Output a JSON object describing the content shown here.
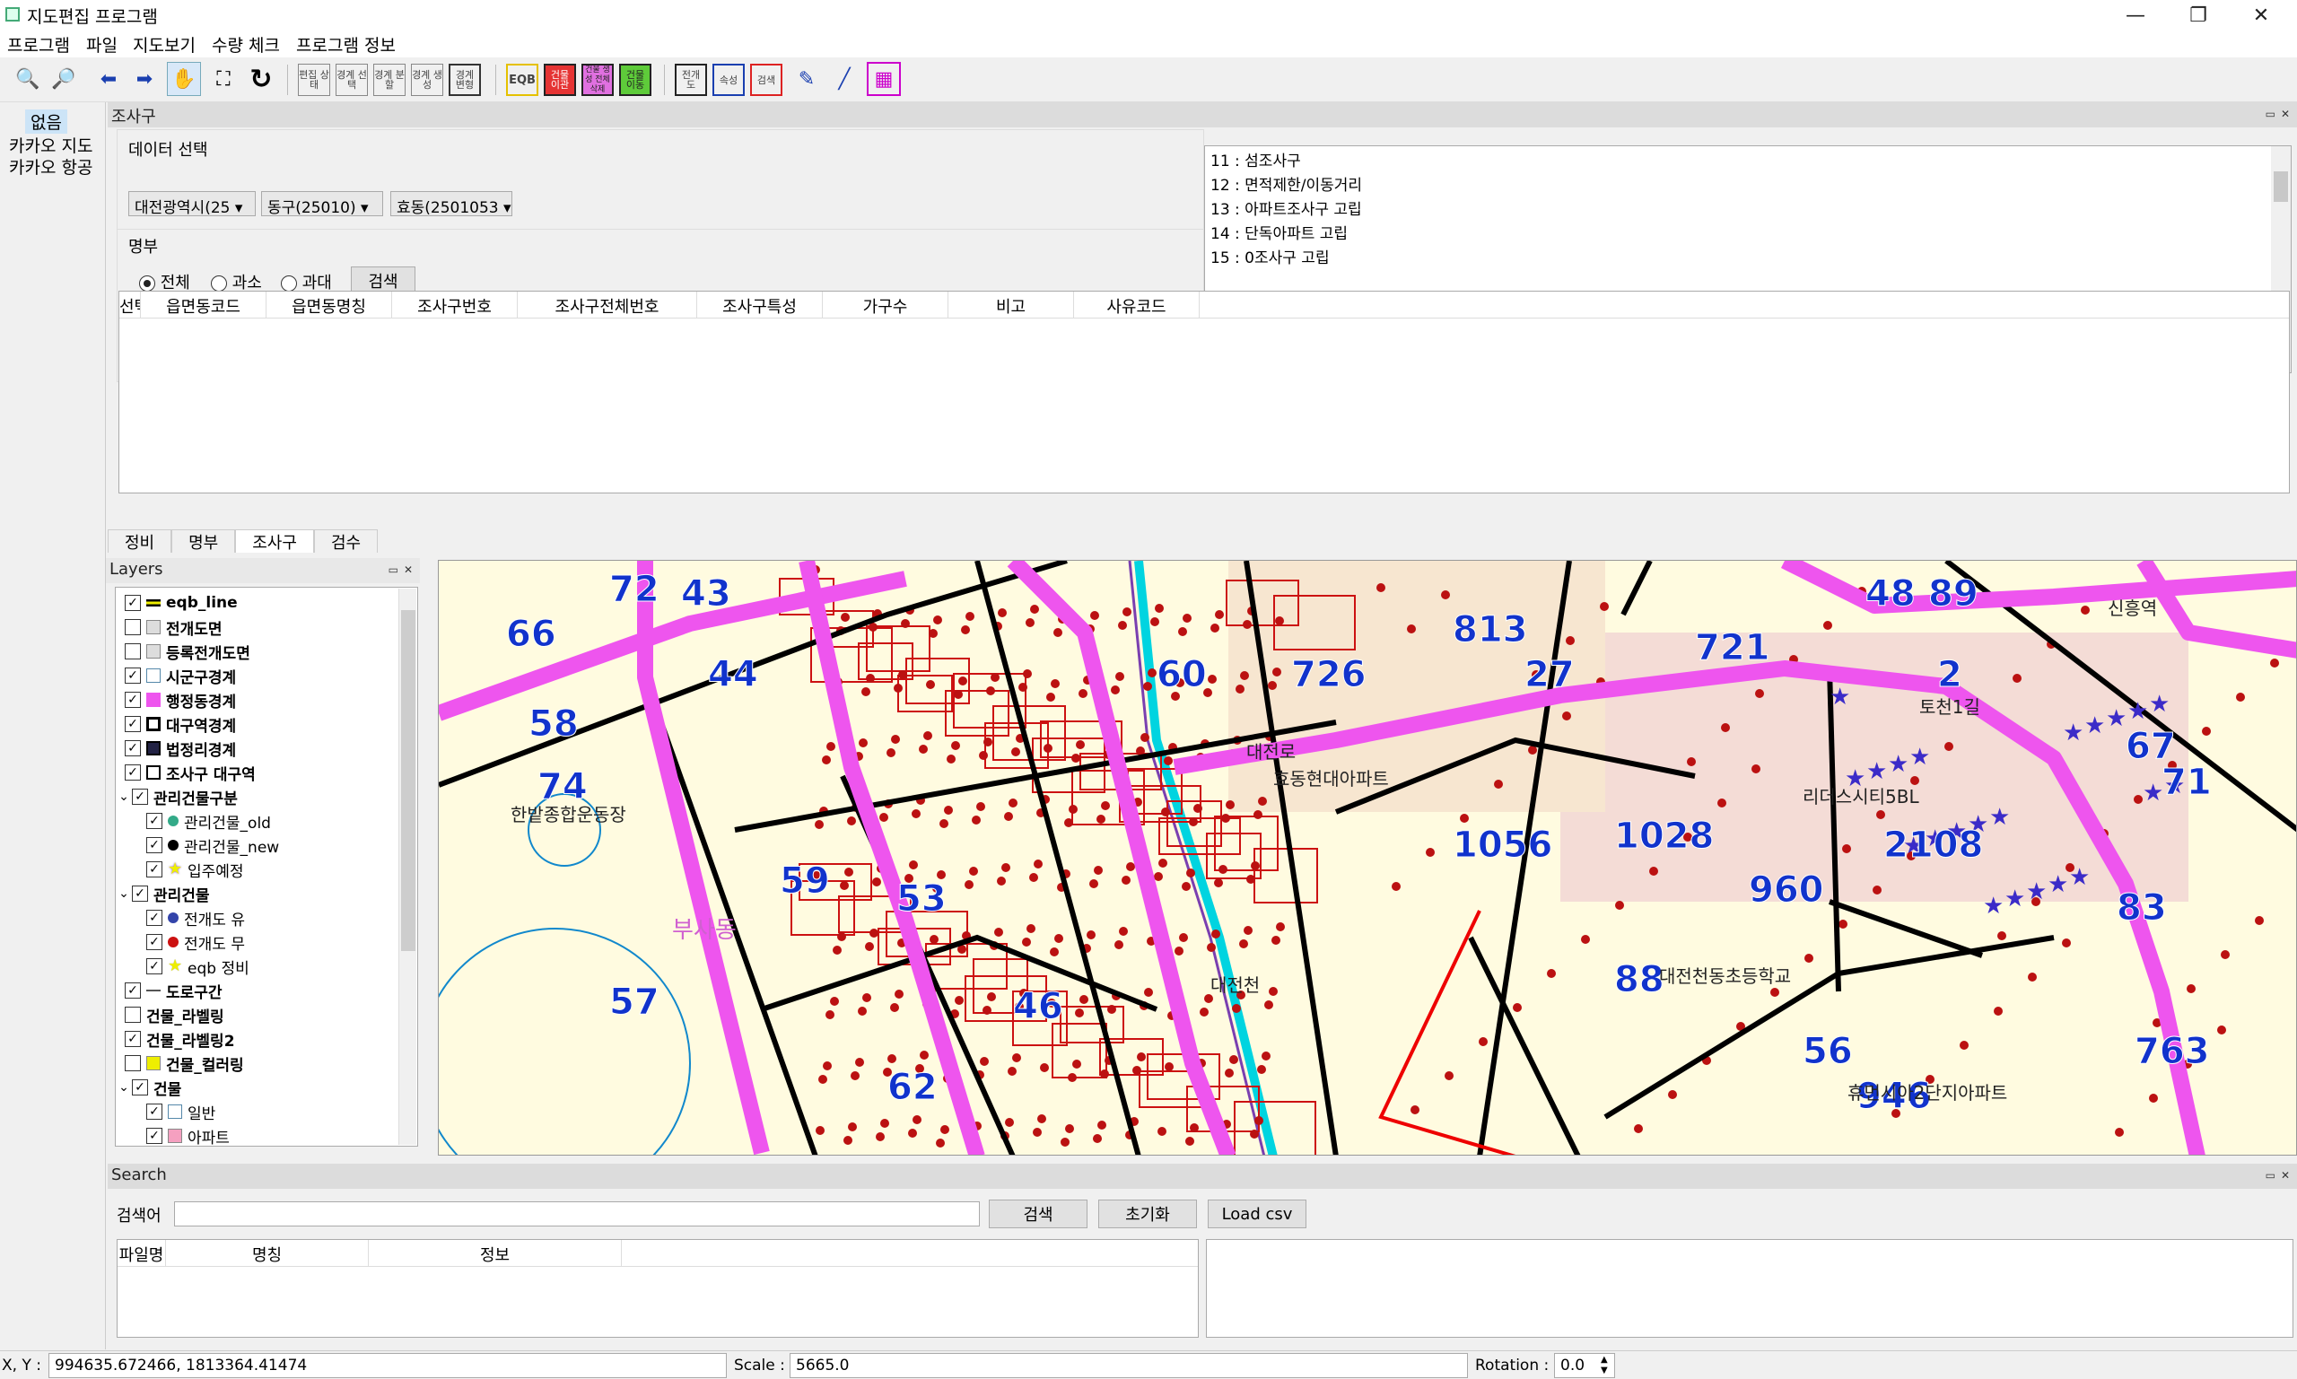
{
  "titlebar": {
    "title": "지도편집 프로그램",
    "minimize": "—",
    "maximize": "❐",
    "close": "✕"
  },
  "menu": [
    "프로그램",
    "파일",
    "지도보기",
    "수량 체크",
    "프로그램 정보"
  ],
  "toolbar": {
    "zoom_in": "🔍",
    "zoom_out": "🔎",
    "back": "⬅",
    "forward": "➡",
    "pan": "✋",
    "full_extent": "⛶",
    "refresh": "↻",
    "text_buttons": [
      "편집 상태",
      "경계 선택",
      "경계 분할",
      "경계 생성",
      "경계 변형"
    ],
    "eqb": "EQB",
    "bldg_move": "건물 이관",
    "bldg_create": "건물 생성 전체삭제",
    "bldg_shift": "건물 이동",
    "full_map": "전개 도",
    "attr": "속성",
    "check": "검색",
    "pick": "✎",
    "draw": "╱",
    "tile": "▦"
  },
  "left_panel": {
    "items": [
      "없음",
      "카카오 지도",
      "카카오 항공"
    ]
  },
  "josagu": {
    "panel_title": "조사구",
    "data_select_label": "데이터 선택",
    "combo_city": "대전광역시(25",
    "combo_gu": "동구(25010)",
    "combo_dong": "효동(2501053",
    "roster_label": "명부",
    "radio_all": "전체",
    "radio_low": "과소",
    "radio_high": "과대",
    "search_button": "검색",
    "code_list": [
      "11 : 섬조사구",
      "12 : 면적제한/이동거리",
      "13 : 아파트조사구 고립",
      "14 : 단독아파트 고립",
      "15 : 0조사구 고립"
    ],
    "table_headers": [
      "선택",
      "읍면동코드",
      "읍면동명칭",
      "조사구번호",
      "조사구전체번호",
      "조사구특성",
      "가구수",
      "비고",
      "사유코드"
    ]
  },
  "tabs": [
    "정비",
    "명부",
    "조사구",
    "검수"
  ],
  "layers": {
    "title": "Layers",
    "rows": [
      {
        "label": "eqb_line",
        "checked": true,
        "bold": true,
        "indent": 1,
        "swatch": "line-yellow"
      },
      {
        "label": "전개도면",
        "checked": false,
        "bold": true,
        "indent": 1,
        "swatch": "gray"
      },
      {
        "label": "등록전개도면",
        "checked": false,
        "bold": true,
        "indent": 1,
        "swatch": "gray"
      },
      {
        "label": "시군구경계",
        "checked": true,
        "bold": true,
        "indent": 1,
        "swatch": "white"
      },
      {
        "label": "행정동경계",
        "checked": true,
        "bold": true,
        "indent": 1,
        "swatch": "magenta"
      },
      {
        "label": "대구역경계",
        "checked": true,
        "bold": true,
        "indent": 1,
        "swatch": "black-box"
      },
      {
        "label": "법정리경계",
        "checked": true,
        "bold": true,
        "indent": 1,
        "swatch": "navy-box"
      },
      {
        "label": "조사구 대구역",
        "checked": true,
        "bold": true,
        "indent": 1,
        "swatch": "outline"
      },
      {
        "label": "관리건물구분",
        "checked": true,
        "bold": true,
        "indent": 0,
        "expander": true
      },
      {
        "label": "관리건물_old",
        "checked": true,
        "bold": false,
        "indent": 2,
        "swatch": "green-dot"
      },
      {
        "label": "관리건물_new",
        "checked": true,
        "bold": false,
        "indent": 2,
        "swatch": "black-dot"
      },
      {
        "label": "입주예정",
        "checked": true,
        "bold": false,
        "indent": 2,
        "swatch": "purple-star"
      },
      {
        "label": "관리건물",
        "checked": true,
        "bold": true,
        "indent": 0,
        "expander": true
      },
      {
        "label": "전개도 유",
        "checked": true,
        "bold": false,
        "indent": 2,
        "swatch": "blue-dot"
      },
      {
        "label": "전개도 무",
        "checked": true,
        "bold": false,
        "indent": 2,
        "swatch": "red-dot"
      },
      {
        "label": "eqb 정비",
        "checked": true,
        "bold": false,
        "indent": 2,
        "swatch": "yellow-star"
      },
      {
        "label": "도로구간",
        "checked": true,
        "bold": true,
        "indent": 1,
        "swatch": "dash"
      },
      {
        "label": "건물_라벨링",
        "checked": false,
        "bold": true,
        "indent": 1
      },
      {
        "label": "건물_라벨링2",
        "checked": true,
        "bold": true,
        "indent": 1
      },
      {
        "label": "건물_컬러링",
        "checked": false,
        "bold": true,
        "indent": 1,
        "swatch": "yellow"
      },
      {
        "label": "건물",
        "checked": true,
        "bold": true,
        "indent": 0,
        "expander": true
      },
      {
        "label": "일반",
        "checked": true,
        "bold": false,
        "indent": 2,
        "swatch": "white"
      },
      {
        "label": "아파트",
        "checked": true,
        "bold": false,
        "indent": 2,
        "swatch": "pink"
      }
    ]
  },
  "map": {
    "labels": [
      {
        "t": "72",
        "c": "blue"
      },
      {
        "t": "43",
        "c": "blue"
      },
      {
        "t": "66",
        "c": "blue"
      },
      {
        "t": "44",
        "c": "blue"
      },
      {
        "t": "58",
        "c": "blue"
      },
      {
        "t": "74",
        "c": "blue"
      },
      {
        "t": "59",
        "c": "blue"
      },
      {
        "t": "57",
        "c": "blue"
      },
      {
        "t": "60",
        "c": "blue"
      },
      {
        "t": "726",
        "c": "blue"
      },
      {
        "t": "813",
        "c": "blue"
      },
      {
        "t": "27",
        "c": "blue"
      },
      {
        "t": "721",
        "c": "blue"
      },
      {
        "t": "48",
        "c": "blue"
      },
      {
        "t": "89",
        "c": "blue"
      },
      {
        "t": "2",
        "c": "blue"
      },
      {
        "t": "67",
        "c": "blue"
      },
      {
        "t": "71",
        "c": "blue"
      },
      {
        "t": "1056",
        "c": "blue"
      },
      {
        "t": "1028",
        "c": "blue"
      },
      {
        "t": "2108",
        "c": "blue"
      },
      {
        "t": "83",
        "c": "blue"
      },
      {
        "t": "88",
        "c": "blue"
      },
      {
        "t": "960",
        "c": "blue"
      },
      {
        "t": "56",
        "c": "blue"
      },
      {
        "t": "946",
        "c": "blue"
      },
      {
        "t": "763",
        "c": "blue"
      },
      {
        "t": "62",
        "c": "blue"
      },
      {
        "t": "46",
        "c": "blue"
      },
      {
        "t": "53",
        "c": "blue"
      }
    ],
    "text_labels": [
      "한밭종합운동장",
      "부사동",
      "대전천",
      "대전로",
      "신흥역",
      "리더스시티5BL",
      "대전천동초등학교",
      "휴먼시아2단지아파트",
      "효동현대아파트",
      "토천1길"
    ]
  },
  "search": {
    "panel_title": "Search",
    "keyword_label": "검색어",
    "search_button": "검색",
    "reset_button": "초기화",
    "load_button": "Load csv",
    "headers": [
      "파일명",
      "명칭",
      "정보"
    ]
  },
  "status": {
    "xy_label": "X, Y :",
    "xy_value": "994635.672466, 1813364.41474",
    "scale_label": "Scale :",
    "scale_value": "5665.0",
    "rotation_label": "Rotation :",
    "rotation_value": "0.0"
  },
  "colors": {
    "boundary": "#ee55ee",
    "road": "#000000",
    "building_red": "#cc1111",
    "label_blue": "#1133cc",
    "water": "#00d4e0"
  }
}
